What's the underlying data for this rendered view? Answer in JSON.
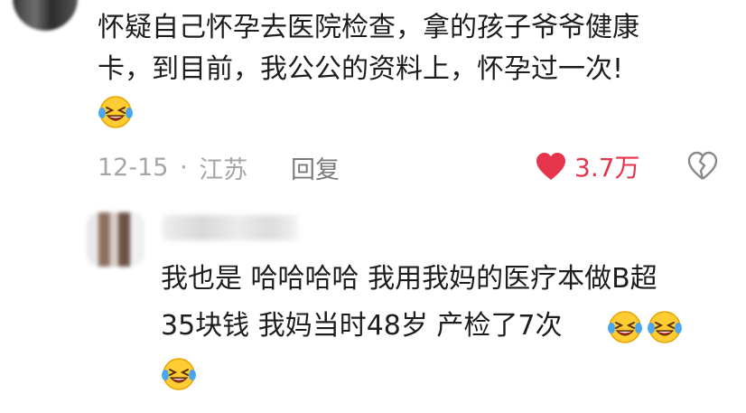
{
  "comment": {
    "line1": "怀疑自己怀孕去医院检查，拿的孩子爷爷健康",
    "line2": "卡，到目前，我公公的资料上，怀孕过一次!",
    "date": "12-15",
    "dot": "·",
    "location": "江苏",
    "reply_label": "回复",
    "like_count": "3.7万",
    "emoji": "grinning-squinting-tears"
  },
  "reply": {
    "line1": "我也是 哈哈哈哈 我用我妈的医疗本做B超",
    "line2": "35块钱 我妈当时48岁 产检了7次",
    "emoji": "grinning-squinting-tears"
  },
  "colors": {
    "like_red": "#e5344b",
    "meta_gray": "#a6a6a6",
    "text": "#1d1d1d"
  }
}
